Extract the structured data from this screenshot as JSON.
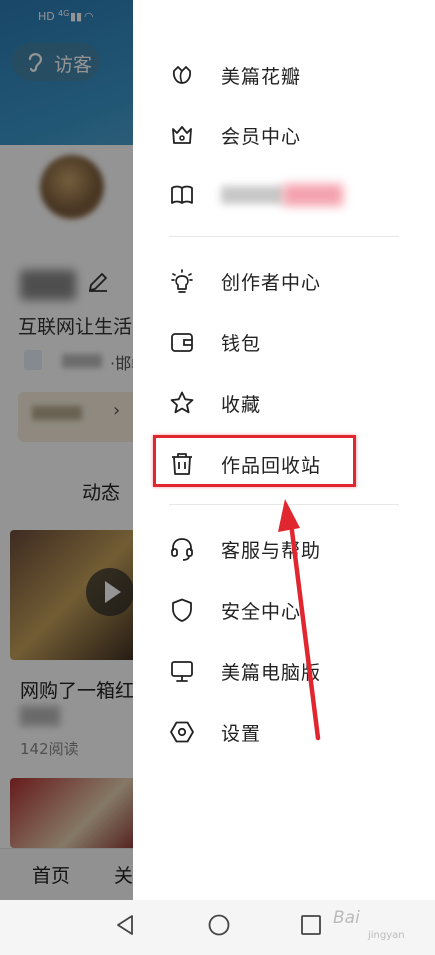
{
  "status_bar": {
    "hd": "HD",
    "net": "4G"
  },
  "profile": {
    "visitor_label": "访客",
    "bio": "互联网让生活",
    "location_suffix": "·邯郸",
    "vip_arrow": "›",
    "tab_dynamic": "动态",
    "post_title": "网购了一箱红",
    "post_reads": "142阅读"
  },
  "bottom_tabs": {
    "home": "首页",
    "follow": "关"
  },
  "drawer": {
    "items": [
      {
        "label": "美篇花瓣",
        "icon": "flower-icon"
      },
      {
        "label": "会员中心",
        "icon": "crown-icon"
      },
      {
        "label": "",
        "icon": "book-icon"
      },
      {
        "label": "创作者中心",
        "icon": "lightbulb-icon"
      },
      {
        "label": "钱包",
        "icon": "wallet-icon"
      },
      {
        "label": "收藏",
        "icon": "star-icon"
      },
      {
        "label": "作品回收站",
        "icon": "trash-icon"
      },
      {
        "label": "客服与帮助",
        "icon": "headset-icon"
      },
      {
        "label": "安全中心",
        "icon": "shield-icon"
      },
      {
        "label": "美篇电脑版",
        "icon": "monitor-icon"
      },
      {
        "label": "设置",
        "icon": "hexagon-gear-icon"
      }
    ],
    "highlight_color": "#e0262f"
  },
  "watermark": {
    "brand": "Bai",
    "sub": "jingyan"
  }
}
